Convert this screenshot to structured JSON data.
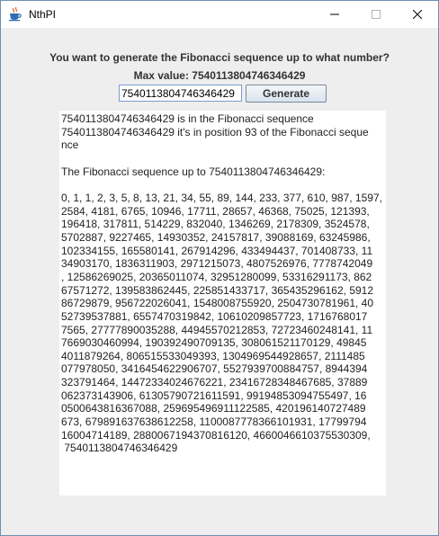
{
  "window": {
    "title": "NthPI",
    "icon": "java-coffee-cup-icon",
    "controls": [
      "minimize-icon",
      "maximize-icon",
      "close-icon"
    ]
  },
  "prompt": {
    "question": "You want to generate the Fibonacci sequence up to what number?",
    "max_value": "Max value: 7540113804746346429"
  },
  "input": {
    "value": "7540113804746346429"
  },
  "button": {
    "generate_label": "Generate"
  },
  "output": {
    "text": "7540113804746346429 is in the Fibonacci sequence\n7540113804746346429 it's in position 93 of the Fibonacci seque\nnce\n\nThe Fibonacci sequence up to 7540113804746346429:\n\n0, 1, 1, 2, 3, 5, 8, 13, 21, 34, 55, 89, 144, 233, 377, 610, 987, 1597,\n2584, 4181, 6765, 10946, 17711, 28657, 46368, 75025, 121393,\n196418, 317811, 514229, 832040, 1346269, 2178309, 3524578,\n5702887, 9227465, 14930352, 24157817, 39088169, 63245986,\n102334155, 165580141, 267914296, 433494437, 701408733, 11\n34903170, 1836311903, 2971215073, 4807526976, 7778742049\n, 12586269025, 20365011074, 32951280099, 53316291173, 862\n67571272, 139583862445, 225851433717, 365435296162, 5912\n86729879, 956722026041, 1548008755920, 2504730781961, 40\n52739537881, 6557470319842, 10610209857723, 1716768017\n7565, 27777890035288, 44945570212853, 72723460248141, 11\n7669030460994, 190392490709135, 308061521170129, 49845\n4011879264, 806515533049393, 1304969544928657, 2111485\n077978050, 3416454622906707, 5527939700884757, 8944394\n323791464, 14472334024676221, 23416728348467685, 37889\n062373143906, 61305790721611591, 99194853094755497, 16\n0500643816367088, 259695496911122585, 420196140727489\n673, 679891637638612258, 1100087778366101931, 17799794\n16004714189, 2880067194370816120, 4660046610375530309,\n 7540113804746346429",
    "background": "#ffffff"
  },
  "colors": {
    "window_bg": "#eeeeee",
    "border": "#6f8fb3"
  }
}
